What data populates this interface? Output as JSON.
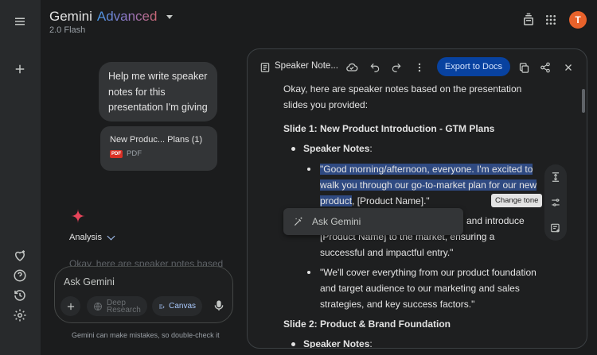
{
  "header": {
    "brand_main": "Gemini",
    "brand_accent": "Advanced",
    "model": "2.0 Flash",
    "avatar_letter": "T"
  },
  "chat": {
    "user_message": "Help me write speaker notes for this presentation I'm giving",
    "file": {
      "name": "New Produc... Plans (1)",
      "type": "PDF",
      "badge": "PDF"
    },
    "analysis_label": "Analysis",
    "faded_preview": "Okay, here are speaker notes based",
    "prompt_placeholder": "Ask Gemini",
    "deep_research_line1": "Deep",
    "deep_research_line2": "Research",
    "canvas_label": "Canvas",
    "disclaimer": "Gemini can make mistakes, so double-check it"
  },
  "canvas": {
    "title": "Speaker Note...",
    "export_label": "Export to Docs",
    "tooltip": "Change tone",
    "ask_label": "Ask Gemini",
    "lines": {
      "intro1": "Okay, here are speaker notes based on the presentation",
      "intro2": "slides you provided:",
      "slide1": "Slide 1: New Product Introduction - GTM Plans",
      "speaker_notes_label": "Speaker Notes",
      "colon": ":",
      "q1_l1": "\"Good morning/afternoon, everyone. I'm excited to",
      "q1_l2": "walk you through our go-to-market plan for our new",
      "q1_l3_hl": "product",
      "q1_l3_rest": ", [Product Name].\"",
      "q2_l1_tail": "and introduce",
      "q2_l2": "[Product Name] to the market, ensuring a",
      "q2_l3": "successful and impactful entry.\"",
      "q3_l1": "\"We'll cover everything from our product foundation",
      "q3_l2": "and target audience to our marketing and sales",
      "q3_l3": "strategies, and key success factors.\"",
      "slide2": "Slide 2: Product & Brand Foundation",
      "speaker_notes_label2": "Speaker Notes",
      "colon2": ":"
    }
  },
  "colors": {
    "background": "#1b1c1d",
    "rail": "#282a2c",
    "accent": "#a8c7fa",
    "export_button": "#0842a0",
    "avatar": "#e8622b",
    "highlight": "#2f4a82"
  },
  "icons": {
    "menu": "menu-icon",
    "new_chat": "plus-icon",
    "gems": "gem-icon",
    "help": "help-icon",
    "activity": "history-icon",
    "settings": "gear-icon",
    "share_top": "share-icon",
    "apps": "apps-grid-icon"
  }
}
